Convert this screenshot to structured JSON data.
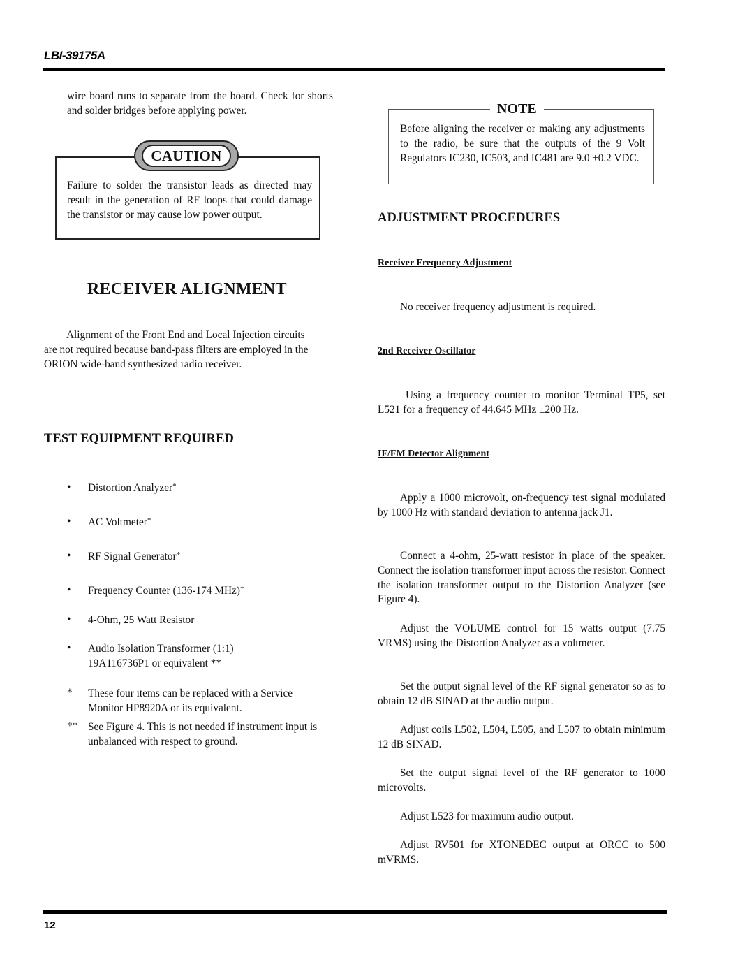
{
  "header": {
    "doc_id": "LBI-39175A"
  },
  "footer": {
    "page_number": "12"
  },
  "left": {
    "intro_text": "wire board runs to separate from the board.  Check for shorts and solder bridges before applying power.",
    "caution": {
      "title": "CAUTION",
      "text": "Failure to solder the transistor leads as directed may result in the generation of RF loops that could damage the transistor or may cause low power output."
    },
    "receiver_alignment": {
      "heading": "RECEIVER ALIGNMENT",
      "text": "Alignment of the Front End and Local Injection circuits are not required because band-pass filters are employed in the ORION wide-band synthesized radio receiver."
    },
    "test_equipment": {
      "heading": "TEST EQUIPMENT REQUIRED",
      "bullet_glyph": "•",
      "items": [
        {
          "text": "Distortion Analyzer",
          "mark": "*"
        },
        {
          "text": "AC Voltmeter",
          "mark": "*"
        },
        {
          "text": "RF Signal Generator",
          "mark": "*"
        },
        {
          "text": "Frequency Counter (136-174 MHz)",
          "mark": "*"
        },
        {
          "text": "4-Ohm, 25 Watt Resistor",
          "mark": ""
        },
        {
          "line1": "Audio Isolation Transformer (1:1)",
          "line2": "19A116736P1 or equivalent **"
        }
      ],
      "footnotes": [
        {
          "mark": "*",
          "text": "These four items can be replaced with a Service Monitor HP8920A or its equivalent."
        },
        {
          "mark": "**",
          "text": "See Figure 4.  This is not needed if instrument input is unbalanced with respect to ground."
        }
      ]
    }
  },
  "right": {
    "note": {
      "title": "NOTE",
      "text": "Before aligning the receiver or making any adjustments to the radio, be sure that the outputs of the 9 Volt Regulators IC230, IC503, and IC481 are 9.0 ±0.2 VDC."
    },
    "adjustment_procedures": {
      "heading": "ADJUSTMENT PROCEDURES",
      "sections": [
        {
          "subheading": "Receiver Frequency Adjustment",
          "paragraphs": [
            "No receiver frequency adjustment is required."
          ]
        },
        {
          "subheading": "2nd Receiver Oscillator",
          "paragraphs": [
            "Using a frequency counter to monitor Terminal TP5, set L521 for a frequency of 44.645 MHz ±200 Hz."
          ]
        },
        {
          "subheading": "IF/FM Detector Alignment",
          "paragraphs": [
            "Apply a 1000 microvolt, on-frequency test signal modulated by 1000 Hz with standard deviation to antenna jack J1.",
            "Connect a 4-ohm, 25-watt resistor in place of the speaker.  Connect the isolation transformer input across the resistor.  Connect the isolation transformer output to the Distortion Analyzer (see Figure 4).",
            "Adjust the VOLUME control for 15 watts output (7.75 VRMS) using the Distortion Analyzer as a voltmeter.",
            "Set the output signal level of the RF signal generator so as to obtain 12 dB SINAD at the audio output.",
            "Adjust coils L502, L504, L505, and L507 to obtain minimum 12 dB SINAD.",
            "Set the output signal level of the RF generator to 1000 microvolts.",
            "Adjust L523 for maximum audio output.",
            "Adjust RV501 for XTONEDEC output at ORCC to 500 mVRMS."
          ]
        }
      ]
    }
  }
}
